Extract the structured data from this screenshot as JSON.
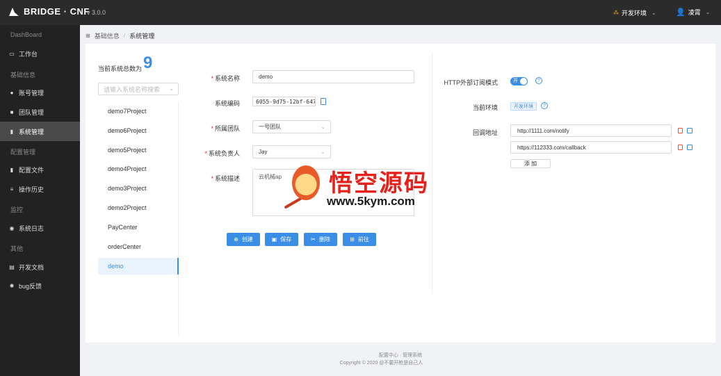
{
  "header": {
    "app_name": "BRIDGE · CNF",
    "version": "v 3.0.0",
    "env_label": "开发环境",
    "user_name": "凌霄"
  },
  "sidebar": {
    "items": [
      {
        "type": "group",
        "label": "DashBoard"
      },
      {
        "type": "item",
        "label": "工作台",
        "icon": "monitor-icon"
      },
      {
        "type": "group",
        "label": "基础信息"
      },
      {
        "type": "item",
        "label": "账号管理",
        "icon": "users-icon"
      },
      {
        "type": "item",
        "label": "团队管理",
        "icon": "team-icon"
      },
      {
        "type": "item",
        "label": "系统管理",
        "icon": "file-icon",
        "active": true
      },
      {
        "type": "group",
        "label": "配置管理"
      },
      {
        "type": "item",
        "label": "配置文件",
        "icon": "config-file-icon"
      },
      {
        "type": "item",
        "label": "操作历史",
        "icon": "list-icon"
      },
      {
        "type": "group",
        "label": "监控"
      },
      {
        "type": "item",
        "label": "系统日志",
        "icon": "log-icon"
      },
      {
        "type": "group",
        "label": "其他"
      },
      {
        "type": "item",
        "label": "开发文档",
        "icon": "book-icon"
      },
      {
        "type": "item",
        "label": "bug反馈",
        "icon": "bug-icon"
      }
    ]
  },
  "breadcrumb": {
    "parent": "基础信息",
    "current": "系统管理"
  },
  "project_list": {
    "total_label": "当前系统总数为",
    "total_count": "9",
    "search_placeholder": "请输入系统名称搜索",
    "items": [
      "demo7Project",
      "demo6Project",
      "demo5Project",
      "demo4Project",
      "demo3Project",
      "demo2Project",
      "PayCenter",
      "orderCenter",
      "demo"
    ],
    "active_index": 8
  },
  "form": {
    "name_label": "系统名称",
    "name_value": "demo",
    "code_label": "系统编码",
    "code_value": "6055-9d75-12bf-647b",
    "team_label": "所属团队",
    "team_value": "一号团队",
    "owner_label": "系统负责人",
    "owner_value": "Jay",
    "desc_label": "系统描述",
    "desc_value": "云机械ap"
  },
  "actions": {
    "create": "创建",
    "save": "保存",
    "delete": "删除",
    "goto": "前往"
  },
  "settings": {
    "http_mode_label": "HTTP外部订阅模式",
    "toggle_text": "开",
    "toggle_on": true,
    "env_label": "当前环境",
    "env_tag": "开发环境",
    "callback_label": "回调地址",
    "callbacks": [
      "http://1111.com/notify",
      "https://112333.com/callback"
    ],
    "add_label": "添 加"
  },
  "watermark": {
    "title": "悟空源码",
    "url": "www.5kym.com"
  },
  "footer": {
    "title": "配置中心 · 管理系统",
    "copyright": "Copyright © 2020 @不要开枪是自己人"
  },
  "colors": {
    "accent": "#3a8ee6",
    "header_bg": "#2b2b2b",
    "sidebar_bg": "#222222",
    "danger": "#e74c3c"
  }
}
